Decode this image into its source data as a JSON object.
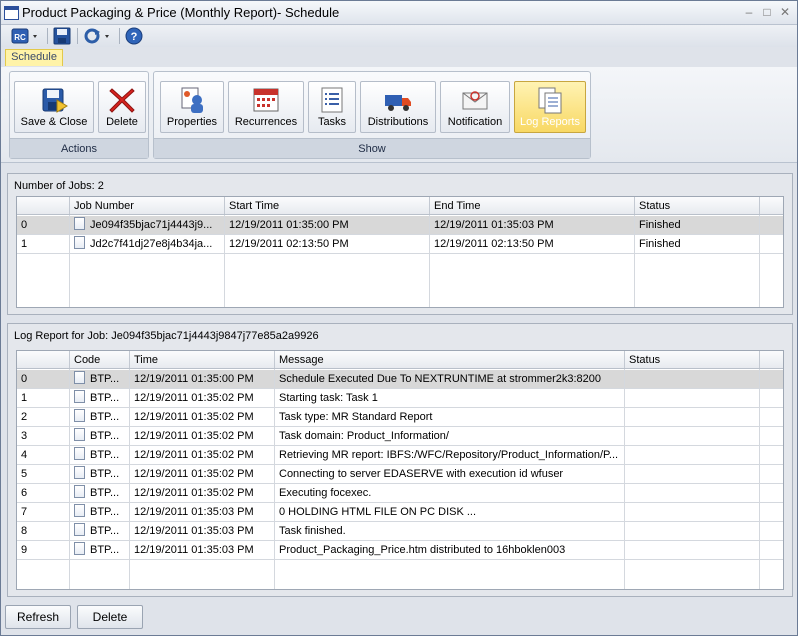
{
  "window": {
    "title": "Product Packaging & Price (Monthly Report)- Schedule",
    "minimize_glyph": "–",
    "restore_glyph": "□",
    "close_glyph": "✕"
  },
  "quick_access": {
    "items": [
      "rc-menu-icon",
      "save-icon",
      "refresh-dropdown-icon",
      "help-icon"
    ]
  },
  "ribbon": {
    "active_tab": "Schedule",
    "groups": [
      {
        "label": "Actions",
        "buttons": [
          "Save & Close",
          "Delete"
        ]
      },
      {
        "label": "Show",
        "buttons": [
          "Properties",
          "Recurrences",
          "Tasks",
          "Distributions",
          "Notification",
          "Log Reports"
        ]
      }
    ],
    "selected_button": "Log Reports"
  },
  "jobs": {
    "title": "Number of Jobs: 2",
    "columns": [
      "Job Number",
      "Start Time",
      "End Time",
      "Status"
    ],
    "rows": [
      {
        "index": "0",
        "job": "Je094f35bjac71j4443j9...",
        "start": "12/19/2011 01:35:00 PM",
        "end": "12/19/2011 01:35:03 PM",
        "status": "Finished"
      },
      {
        "index": "1",
        "job": "Jd2c7f41dj27e8j4b34ja...",
        "start": "12/19/2011 02:13:50 PM",
        "end": "12/19/2011 02:13:50 PM",
        "status": "Finished"
      }
    ]
  },
  "log": {
    "title": "Log Report for Job: Je094f35bjac71j4443j9847j77e85a2a9926",
    "columns": [
      "Code",
      "Time",
      "Message",
      "Status"
    ],
    "rows": [
      {
        "index": "0",
        "code": "BTP...",
        "time": "12/19/2011 01:35:00 PM",
        "message": "Schedule Executed Due To NEXTRUNTIME at strommer2k3:8200",
        "status": ""
      },
      {
        "index": "1",
        "code": "BTP...",
        "time": "12/19/2011 01:35:02 PM",
        "message": "Starting task: Task 1",
        "status": ""
      },
      {
        "index": "2",
        "code": "BTP...",
        "time": "12/19/2011 01:35:02 PM",
        "message": "Task type: MR Standard Report",
        "status": ""
      },
      {
        "index": "3",
        "code": "BTP...",
        "time": "12/19/2011 01:35:02 PM",
        "message": "Task domain: Product_Information/",
        "status": ""
      },
      {
        "index": "4",
        "code": "BTP...",
        "time": "12/19/2011 01:35:02 PM",
        "message": "Retrieving MR report: IBFS:/WFC/Repository/Product_Information/P...",
        "status": ""
      },
      {
        "index": "5",
        "code": "BTP...",
        "time": "12/19/2011 01:35:02 PM",
        "message": "Connecting to server EDASERVE with execution id wfuser",
        "status": ""
      },
      {
        "index": "6",
        "code": "BTP...",
        "time": "12/19/2011 01:35:02 PM",
        "message": "Executing focexec.",
        "status": ""
      },
      {
        "index": "7",
        "code": "BTP...",
        "time": "12/19/2011 01:35:03 PM",
        "message": "0 HOLDING HTML FILE ON PC DISK ...",
        "status": ""
      },
      {
        "index": "8",
        "code": "BTP...",
        "time": "12/19/2011 01:35:03 PM",
        "message": "Task finished.",
        "status": ""
      },
      {
        "index": "9",
        "code": "BTP...",
        "time": "12/19/2011 01:35:03 PM",
        "message": "Product_Packaging_Price.htm distributed to 16hboklen003",
        "status": ""
      }
    ]
  },
  "footer": {
    "refresh_label": "Refresh",
    "delete_label": "Delete"
  },
  "colors": {
    "accent": "#f8d864",
    "selected_row": "#d8d8d8"
  }
}
